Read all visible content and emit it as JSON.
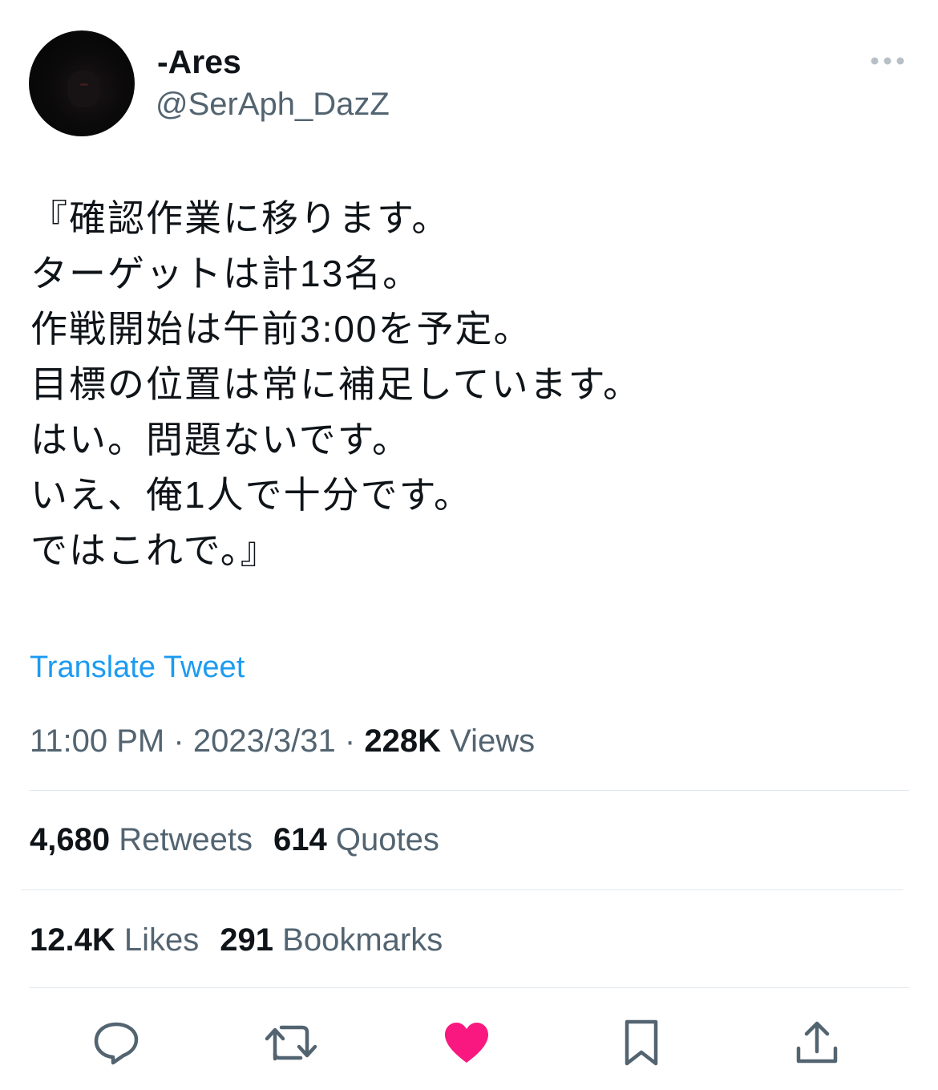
{
  "author": {
    "display_name": "-Ares",
    "handle": "@SerAph_DazZ"
  },
  "tweet": {
    "text": "『確認作業に移ります。\nターゲットは計13名。\n作戦開始は午前3:00を予定。\n目標の位置は常に補足しています。\nはい。問題ないです。\nいえ、俺1人で十分です。\nではこれで。』",
    "translate_label": "Translate Tweet"
  },
  "meta": {
    "time": "11:00 PM",
    "separator": "·",
    "date": "2023/3/31",
    "views_count": "228K",
    "views_label": "Views"
  },
  "stats": {
    "retweets_count": "4,680",
    "retweets_label": "Retweets",
    "quotes_count": "614",
    "quotes_label": "Quotes",
    "likes_count": "12.4K",
    "likes_label": "Likes",
    "bookmarks_count": "291",
    "bookmarks_label": "Bookmarks"
  },
  "actions": {
    "reply_icon": "reply-icon",
    "retweet_icon": "retweet-icon",
    "like_icon": "heart-icon",
    "bookmark_icon": "bookmark-icon",
    "share_icon": "share-icon",
    "liked": true
  },
  "colors": {
    "text": "#0f1419",
    "secondary": "#536471",
    "link": "#1d9bf0",
    "like": "#f91880",
    "divider": "#e1e8ed"
  }
}
